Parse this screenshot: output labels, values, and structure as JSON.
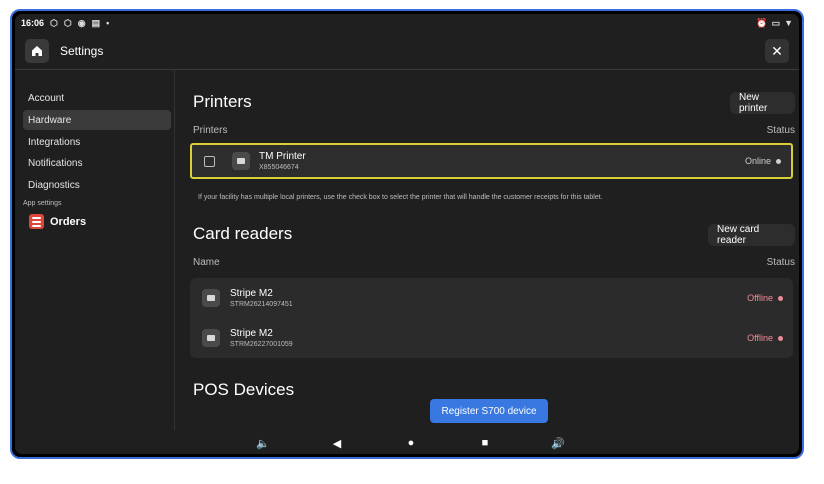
{
  "statusbar": {
    "time": "16:06",
    "left_icons": [
      "app-icon-1",
      "app-icon-2",
      "shield-icon",
      "printer-icon",
      "dot-icon"
    ],
    "right_icons": [
      "alarm-icon",
      "battery-icon",
      "wifi-icon"
    ]
  },
  "appbar": {
    "title": "Settings",
    "home_icon": "home-icon",
    "close_glyph": "✕"
  },
  "sidebar": {
    "items": [
      {
        "label": "Account"
      },
      {
        "label": "Hardware",
        "active": true
      },
      {
        "label": "Integrations"
      },
      {
        "label": "Notifications"
      },
      {
        "label": "Diagnostics"
      }
    ],
    "section_label": "App settings",
    "orders_label": "Orders"
  },
  "printers": {
    "title": "Printers",
    "new_button": "New printer",
    "col_name": "Printers",
    "col_status": "Status",
    "rows": [
      {
        "name": "TM Printer",
        "serial": "X855046674",
        "status": "Online",
        "status_color": "#cfcfcf"
      }
    ],
    "hint": "If your facility has multiple local printers, use the check box to select the printer that will handle the customer receipts for this tablet."
  },
  "card_readers": {
    "title": "Card readers",
    "new_button": "New card reader",
    "col_name": "Name",
    "col_status": "Status",
    "rows": [
      {
        "name": "Stripe M2",
        "serial": "STRM26214097451",
        "status": "Offline",
        "status_color": "#f08a96"
      },
      {
        "name": "Stripe M2",
        "serial": "STRM26227001059",
        "status": "Offline",
        "status_color": "#f08a96"
      }
    ]
  },
  "pos_devices": {
    "title": "POS Devices",
    "register_button": "Register S700 device"
  },
  "colors": {
    "accent": "#3878e0",
    "highlight": "#d8d036",
    "background": "#1f1f1f",
    "offline": "#f08a96"
  },
  "navbar": {
    "vol_down": "🔈",
    "back": "◀",
    "home": "●",
    "recents": "■",
    "vol_up": "🔊"
  }
}
